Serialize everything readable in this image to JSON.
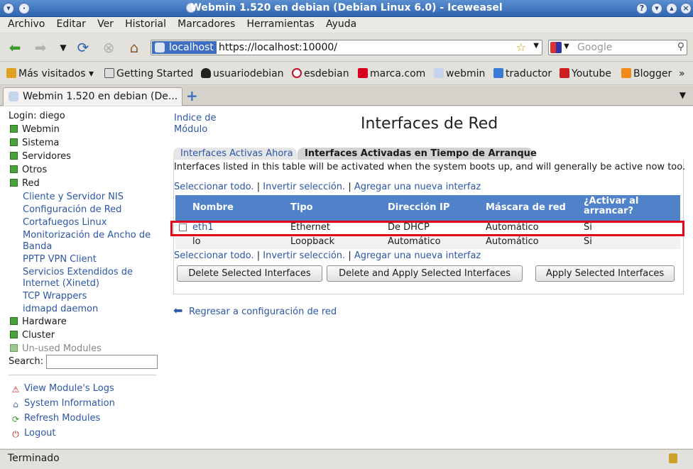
{
  "window": {
    "title": "Webmin 1.520 en debian (Debian Linux 6.0) - Iceweasel"
  },
  "menu": [
    "Archivo",
    "Editar",
    "Ver",
    "Historial",
    "Marcadores",
    "Herramientas",
    "Ayuda"
  ],
  "url": {
    "site": "localhost",
    "address": "https://localhost:10000/"
  },
  "search": {
    "placeholder": "Google"
  },
  "bookmarks": [
    "Más visitados",
    "Getting Started",
    "usuariodebian",
    "esdebian",
    "marca.com",
    "webmin",
    "traductor",
    "Youtube",
    "Blogger"
  ],
  "tab": {
    "label": "Webmin 1.520 en debian (De..."
  },
  "sidebar": {
    "login": "Login: diego",
    "categories": {
      "webmin": "Webmin",
      "sistema": "Sistema",
      "servidores": "Servidores",
      "otros": "Otros",
      "red": "Red",
      "hardware": "Hardware",
      "cluster": "Cluster",
      "unused": "Un-used Modules"
    },
    "red_items": [
      "Cliente y Servidor NIS",
      "Configuración de Red",
      "Cortafuegos Linux",
      "Monitorización de Ancho de",
      "Banda",
      "PPTP VPN Client",
      "Servicios Extendidos de",
      "Internet (Xinetd)",
      "TCP Wrappers",
      "idmapd daemon"
    ],
    "search_label": "Search:",
    "actions": [
      "View Module's Logs",
      "System Information",
      "Refresh Modules",
      "Logout"
    ]
  },
  "main": {
    "module_index": [
      "Indice de",
      "Módulo"
    ],
    "title": "Interfaces de Red",
    "tabs": [
      "Interfaces Activas Ahora",
      "Interfaces Activadas en Tiempo de Arranque"
    ],
    "description": "Interfaces listed in this table will be activated when the system boots up, and will generally be active now too.",
    "select_all": "Seleccionar todo.",
    "invert": "Invertir selección.",
    "add": "Agregar una nueva interfaz",
    "separator": "|",
    "columns": [
      "Nombre",
      "Tipo",
      "Dirección IP",
      "Máscara de red",
      "¿Activar al",
      "arrancar?"
    ],
    "rows": [
      [
        "eth1",
        "Ethernet",
        "De DHCP",
        "Automático",
        "Si"
      ],
      [
        "lo",
        "Loopback",
        "Automático",
        "Automático",
        "Si"
      ]
    ],
    "buttons": [
      "Delete Selected Interfaces",
      "Delete and Apply Selected Interfaces",
      "Apply Selected Interfaces"
    ],
    "back": "Regresar a configuración de red"
  },
  "status": {
    "text": "Terminado"
  }
}
